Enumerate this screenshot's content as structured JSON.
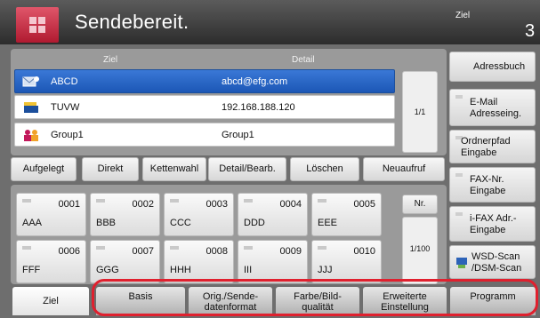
{
  "header": {
    "title": "Sendebereit.",
    "dest_label": "Ziel",
    "dest_count": "3",
    "home_icon": "home-icon"
  },
  "dest_list": {
    "col_ziel": "Ziel",
    "col_detail": "Detail",
    "rows": [
      {
        "name": "ABCD",
        "detail": "abcd@efg.com",
        "icon": "email-icon",
        "selected": true
      },
      {
        "name": "TUVW",
        "detail": "192.168.188.120",
        "icon": "folder-icon",
        "selected": false
      },
      {
        "name": "Group1",
        "detail": "Group1",
        "icon": "group-icon",
        "selected": false
      }
    ],
    "page": "1/1"
  },
  "right_buttons": [
    {
      "label": "Adressbuch"
    },
    {
      "label": "E-Mail Adresseing."
    },
    {
      "label": "Ordnerpfad Eingabe"
    },
    {
      "label": "FAX-Nr. Eingabe"
    },
    {
      "label": "i-FAX Adr.-Eingabe"
    },
    {
      "label": "WSD-Scan /DSM-Scan"
    }
  ],
  "actions": [
    "Aufgelegt",
    "Direkt",
    "Kettenwahl",
    "Detail/Bearb.",
    "Löschen",
    "Neuaufruf"
  ],
  "keys": [
    {
      "num": "0001",
      "name": "AAA"
    },
    {
      "num": "0002",
      "name": "BBB"
    },
    {
      "num": "0003",
      "name": "CCC"
    },
    {
      "num": "0004",
      "name": "DDD"
    },
    {
      "num": "0005",
      "name": "EEE"
    },
    {
      "num": "0006",
      "name": "FFF"
    },
    {
      "num": "0007",
      "name": "GGG"
    },
    {
      "num": "0008",
      "name": "HHH"
    },
    {
      "num": "0009",
      "name": "III"
    },
    {
      "num": "0010",
      "name": "JJJ"
    }
  ],
  "keys_nr": "Nr.",
  "keys_page": "1/100",
  "tabs": [
    {
      "line1": "Ziel",
      "line2": ""
    },
    {
      "line1": "Basis",
      "line2": ""
    },
    {
      "line1": "Orig./Sende-",
      "line2": "datenformat"
    },
    {
      "line1": "Farbe/Bild-",
      "line2": "qualität"
    },
    {
      "line1": "Erweiterte",
      "line2": "Einstellung"
    },
    {
      "line1": "Programm",
      "line2": ""
    }
  ],
  "colors": {
    "accent_red": "#e0202e",
    "selected_blue": "#2a66c8"
  }
}
